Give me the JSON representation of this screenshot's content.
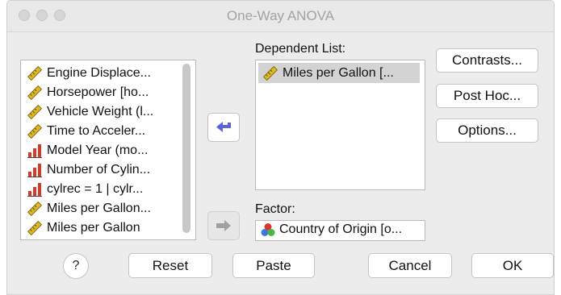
{
  "window": {
    "title": "One-Way ANOVA"
  },
  "variables": [
    {
      "label": "Engine Displace...",
      "icon": "ruler-scale-icon"
    },
    {
      "label": "Horsepower [ho...",
      "icon": "ruler-scale-icon"
    },
    {
      "label": "Vehicle Weight (l...",
      "icon": "ruler-scale-icon"
    },
    {
      "label": "Time to Acceler...",
      "icon": "ruler-scale-icon"
    },
    {
      "label": "Model Year (mo...",
      "icon": "bar-ordinal-icon"
    },
    {
      "label": "Number of Cylin...",
      "icon": "bar-ordinal-icon"
    },
    {
      "label": "cylrec = 1 | cylr...",
      "icon": "bar-ordinal-icon"
    },
    {
      "label": "Miles per Gallon...",
      "icon": "ruler-scale-icon"
    },
    {
      "label": "Miles per Gallon",
      "icon": "ruler-scale-icon"
    }
  ],
  "dependent": {
    "label": "Dependent List:",
    "items": [
      {
        "label": "Miles per Gallon [...",
        "icon": "ruler-scale-icon"
      }
    ]
  },
  "factor": {
    "label": "Factor:",
    "value": "Country of Origin [o...",
    "icon": "nominal-circles-icon"
  },
  "side_buttons": {
    "contrasts": "Contrasts...",
    "post_hoc": "Post Hoc...",
    "options": "Options..."
  },
  "bottom_buttons": {
    "help": "?",
    "reset": "Reset",
    "paste": "Paste",
    "cancel": "Cancel",
    "ok": "OK"
  },
  "colors": {
    "arrow_active": "#5b63d6",
    "arrow_disabled": "#a0a0a0",
    "ruler": "#e0b820",
    "bar_red": "#d73a2a"
  }
}
